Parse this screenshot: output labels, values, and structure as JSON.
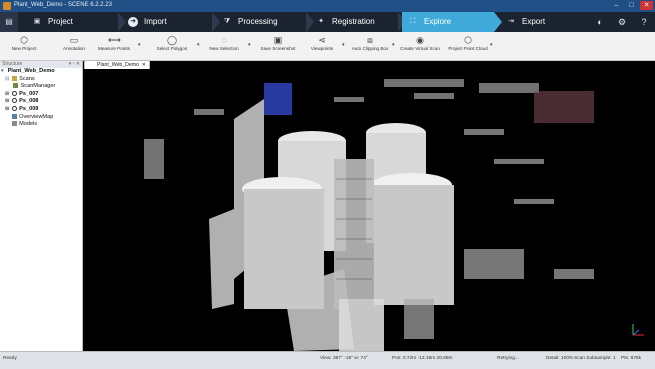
{
  "window": {
    "title": "Plant_Web_Demo - SCENE 6.2.2.23"
  },
  "tabs": [
    {
      "label": "Project",
      "icon": "project-icon"
    },
    {
      "label": "Import",
      "icon": "import-icon"
    },
    {
      "label": "Processing",
      "icon": "processing-icon"
    },
    {
      "label": "Registration",
      "icon": "registration-icon"
    },
    {
      "label": "Explore",
      "icon": "explore-icon",
      "active": true
    },
    {
      "label": "Export",
      "icon": "export-icon"
    }
  ],
  "ribbon": [
    {
      "label": "New Project",
      "icon": "cube-icon"
    },
    {
      "label": "Annotation",
      "icon": "annotation-icon"
    },
    {
      "label": "Measure Points",
      "icon": "measure-icon"
    },
    {
      "label": "Select Polygon",
      "icon": "polygon-icon"
    },
    {
      "label": "New Selection",
      "icon": "selection-icon"
    },
    {
      "label": "Save Screenshot",
      "icon": "camera-icon"
    },
    {
      "label": "Viewpoints",
      "icon": "viewpoints-icon"
    },
    {
      "label": "Auto Clipping Box",
      "icon": "clipping-box-icon"
    },
    {
      "label": "Create Virtual Scan",
      "icon": "virtual-scan-icon"
    },
    {
      "label": "Project Point Cloud",
      "icon": "point-cloud-icon"
    }
  ],
  "sidepanel": {
    "title": "Structure",
    "tree": [
      {
        "label": "Plant_Web_Demo",
        "bold": true
      },
      {
        "label": "Scans"
      },
      {
        "label": "ScanManager"
      },
      {
        "label": "Ps_007",
        "bold": true
      },
      {
        "label": "Ps_008",
        "bold": true
      },
      {
        "label": "Ps_009",
        "bold": true
      },
      {
        "label": "OverviewMap"
      },
      {
        "label": "Models"
      }
    ]
  },
  "document": {
    "tab_label": "Plant_Web_Demo"
  },
  "statusbar": {
    "left": "Ready",
    "view": "View: 357° -18° w: 74°",
    "pos": "Pos: 0.72m -12.19m 20.69m",
    "retry": "Retrying...",
    "detail": "Detail: 100%",
    "subsample": "Scan Subsample: 1",
    "pts": "Pts: 676k"
  },
  "colors": {
    "accent": "#3fa9d9",
    "tabbar": "#1b2230",
    "titlebar": "#1f4f84"
  }
}
